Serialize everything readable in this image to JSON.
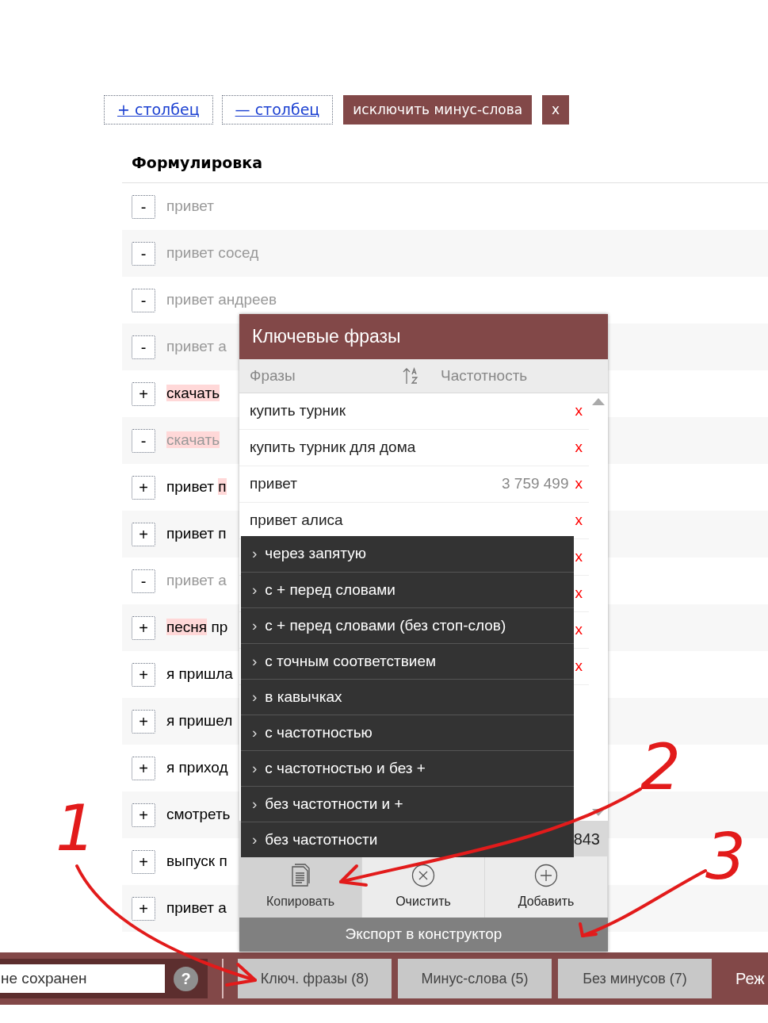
{
  "toolbar": [
    {
      "kind": "link",
      "label": "+ столбец"
    },
    {
      "kind": "link",
      "label": "— столбец"
    },
    {
      "kind": "action",
      "label": "исключить минус-слова"
    },
    {
      "kind": "action",
      "label": "x"
    }
  ],
  "table": {
    "heading": "Формулировка",
    "rows": [
      {
        "sign": "-",
        "excluded": true,
        "parts": [
          {
            "text": "привет",
            "highlight": false
          }
        ]
      },
      {
        "sign": "-",
        "excluded": true,
        "parts": [
          {
            "text": "привет сосед",
            "highlight": false
          }
        ]
      },
      {
        "sign": "-",
        "excluded": true,
        "parts": [
          {
            "text": "привет андреев",
            "highlight": false
          }
        ]
      },
      {
        "sign": "-",
        "excluded": true,
        "parts": [
          {
            "text": "привет а",
            "highlight": false
          }
        ]
      },
      {
        "sign": "+",
        "excluded": false,
        "parts": [
          {
            "text": "скачать",
            "highlight": true
          }
        ]
      },
      {
        "sign": "-",
        "excluded": true,
        "parts": [
          {
            "text": "скачать",
            "highlight": true
          }
        ]
      },
      {
        "sign": "+",
        "excluded": false,
        "parts": [
          {
            "text": "привет ",
            "highlight": false
          },
          {
            "text": "п",
            "highlight": true
          }
        ]
      },
      {
        "sign": "+",
        "excluded": false,
        "parts": [
          {
            "text": "привет п",
            "highlight": false
          }
        ]
      },
      {
        "sign": "-",
        "excluded": true,
        "parts": [
          {
            "text": "привет а",
            "highlight": false
          }
        ]
      },
      {
        "sign": "+",
        "excluded": false,
        "parts": [
          {
            "text": "песня",
            "highlight": true
          },
          {
            "text": " пр",
            "highlight": false
          }
        ]
      },
      {
        "sign": "+",
        "excluded": false,
        "parts": [
          {
            "text": "я пришла",
            "highlight": false
          }
        ]
      },
      {
        "sign": "+",
        "excluded": false,
        "parts": [
          {
            "text": "я пришел",
            "highlight": false
          }
        ]
      },
      {
        "sign": "+",
        "excluded": false,
        "parts": [
          {
            "text": "я приход",
            "highlight": false
          }
        ]
      },
      {
        "sign": "+",
        "excluded": false,
        "parts": [
          {
            "text": "смотреть",
            "highlight": false
          }
        ]
      },
      {
        "sign": "+",
        "excluded": false,
        "parts": [
          {
            "text": "выпуск п",
            "highlight": false
          }
        ]
      },
      {
        "sign": "+",
        "excluded": false,
        "parts": [
          {
            "text": "привет а",
            "highlight": false
          }
        ]
      }
    ]
  },
  "popup": {
    "title": "Ключевые фразы",
    "columns": [
      "Фразы",
      "Частотность"
    ],
    "phrases": [
      {
        "text": "купить турник",
        "remove": "x"
      },
      {
        "text": "купить турник для дома",
        "remove": "x"
      },
      {
        "text": "привет",
        "frequency": "3 759 499",
        "remove": "x"
      },
      {
        "text": "привет алиса",
        "remove": "x"
      },
      {
        "remove": "x"
      },
      {
        "remove": "x"
      },
      {
        "remove": "x"
      },
      {
        "remove": "x"
      }
    ],
    "footer_count": "843",
    "copy_menu": [
      {
        "chevron": "›",
        "label": "через запятую"
      },
      {
        "chevron": "›",
        "label": "с + перед словами"
      },
      {
        "chevron": "›",
        "label": "с + перед словами (без стоп-слов)"
      },
      {
        "chevron": "›",
        "label": "с точным соответствием"
      },
      {
        "chevron": "›",
        "label": "в кавычках"
      },
      {
        "chevron": "›",
        "label": "с частотностью"
      },
      {
        "chevron": "›",
        "label": "с частотностью и без +"
      },
      {
        "chevron": "›",
        "label": "без частотности и +"
      },
      {
        "chevron": "›",
        "label": "без частотности"
      }
    ],
    "actions": [
      {
        "kind": "copy",
        "label": "Копировать",
        "selected": true
      },
      {
        "kind": "clear",
        "label": "Очистить",
        "selected": false
      },
      {
        "kind": "add",
        "label": "Добавить",
        "selected": false
      }
    ],
    "export": "Экспорт в конструктор"
  },
  "bottom_bar": {
    "name_value": "не сохранен",
    "help": "?",
    "tabs": [
      {
        "label": "Ключ. фразы (8)"
      },
      {
        "label": "Минус-слова (5)"
      },
      {
        "label": "Без минусов (7)"
      }
    ],
    "mode": "Реж"
  },
  "annotations": [
    {
      "label": "1"
    },
    {
      "label": "2"
    },
    {
      "label": "3"
    }
  ]
}
